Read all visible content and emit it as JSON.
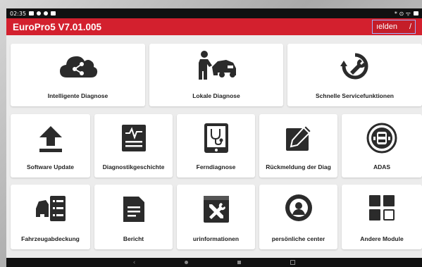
{
  "status": {
    "time": "02:35",
    "right_text": "* ⊙ ᯤ"
  },
  "header": {
    "title": "EuroPro5 V7.01.005",
    "login_label": "ıelden",
    "login_suffix": "/"
  },
  "tiles": [
    {
      "label": "Intelligente Diagnose",
      "icon": "cloud-share-icon"
    },
    {
      "label": "Lokale Diagnose",
      "icon": "mechanic-car-icon"
    },
    {
      "label": "Schnelle Servicefunktionen",
      "icon": "wrench-refresh-icon"
    },
    {
      "label": "Software Update",
      "icon": "upload-icon"
    },
    {
      "label": "Diagnostikgeschichte",
      "icon": "history-doc-icon"
    },
    {
      "label": "Ferndiagnose",
      "icon": "stethoscope-tablet-icon"
    },
    {
      "label": "Rückmeldung der Diag",
      "icon": "feedback-pencil-icon"
    },
    {
      "label": "ADAS",
      "icon": "adas-car-icon"
    },
    {
      "label": "Fahrzeugabdeckung",
      "icon": "vehicle-coverage-icon"
    },
    {
      "label": "Bericht",
      "icon": "report-icon"
    },
    {
      "label": "urinformationen",
      "icon": "repair-info-icon"
    },
    {
      "label": "persönliche center",
      "icon": "user-center-icon"
    },
    {
      "label": "Andere Module",
      "icon": "modules-grid-icon"
    }
  ],
  "colors": {
    "brand_red": "#d3202e",
    "icon_dark": "#2b2b2b"
  }
}
